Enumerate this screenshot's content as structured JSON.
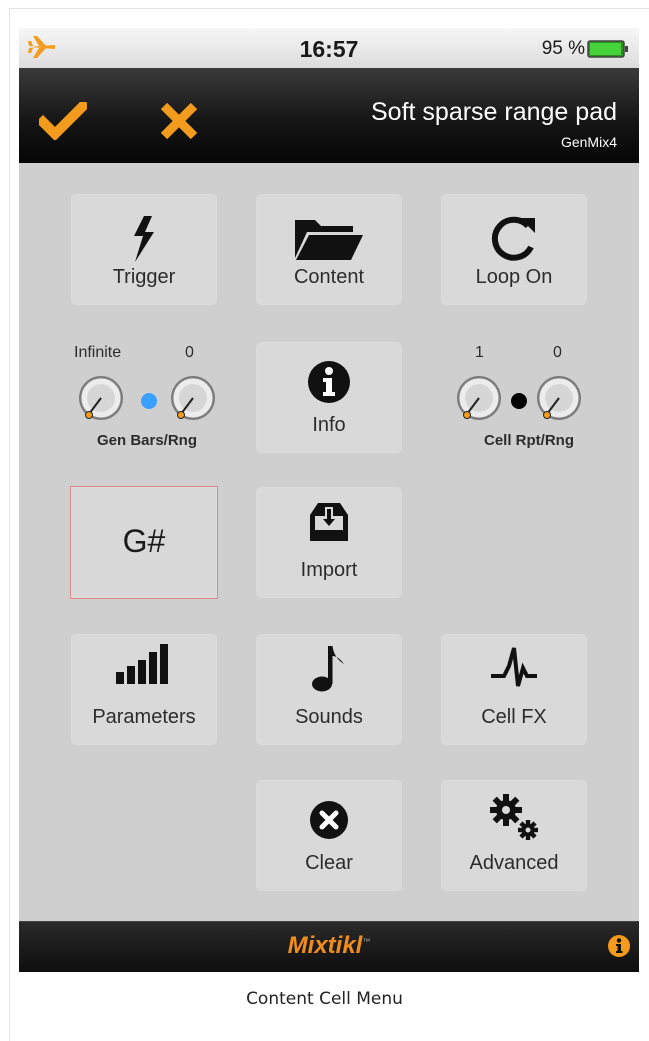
{
  "status_bar": {
    "time": "16:57",
    "battery": "95 %"
  },
  "header": {
    "title": "Soft sparse range pad",
    "subtitle": "GenMix4"
  },
  "tiles": {
    "trigger": "Trigger",
    "content": "Content",
    "loop": "Loop On",
    "info": "Info",
    "key": "G#",
    "import": "Import",
    "parameters": "Parameters",
    "sounds": "Sounds",
    "cell_fx": "Cell FX",
    "clear": "Clear",
    "advanced": "Advanced"
  },
  "gen_knobs": {
    "left_value": "Infinite",
    "right_value": "0",
    "caption": "Gen Bars/Rng",
    "dot_color": "#3aa0ff"
  },
  "cell_knobs": {
    "left_value": "1",
    "right_value": "0",
    "caption": "Cell Rpt/Rng",
    "dot_color": "#000000"
  },
  "footer": {
    "logo": "Mixtikl",
    "trademark": "™"
  },
  "caption": "Content Cell Menu",
  "colors": {
    "accent": "#f39b1d",
    "header_bg": "#111111",
    "screen_bg": "#cfcfcf"
  }
}
